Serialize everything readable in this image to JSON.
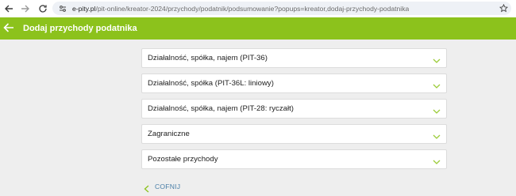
{
  "browser": {
    "url_domain": "e-pity.pl",
    "url_path": "/pit-online/kreator-2024/przychody/podatnik/podsumowanie?popups=kreator,dodaj-przychody-podatnika"
  },
  "header": {
    "title": "Dodaj przychody podatnika"
  },
  "income_types": [
    {
      "label": "Działalność, spółka, najem (PIT-36)"
    },
    {
      "label": "Działalność, spółka (PIT-36L: liniowy)"
    },
    {
      "label": "Działalność, spółka, najem (PIT-28: ryczałt)"
    },
    {
      "label": "Zagraniczne"
    },
    {
      "label": "Pozostałe przychody"
    }
  ],
  "back_link": {
    "label": "COFNIJ"
  },
  "colors": {
    "brand_green": "#8cc21c",
    "link_blue": "#4a7fa8"
  },
  "icons": {
    "browser_back": "arrow-left-icon",
    "browser_forward": "arrow-right-icon",
    "browser_reload": "reload-icon",
    "site_info": "tune-icon",
    "bookmark": "star-icon",
    "header_back": "arrow-left-icon",
    "card_expand": "chevron-down-icon",
    "back_link": "chevron-left-icon"
  }
}
